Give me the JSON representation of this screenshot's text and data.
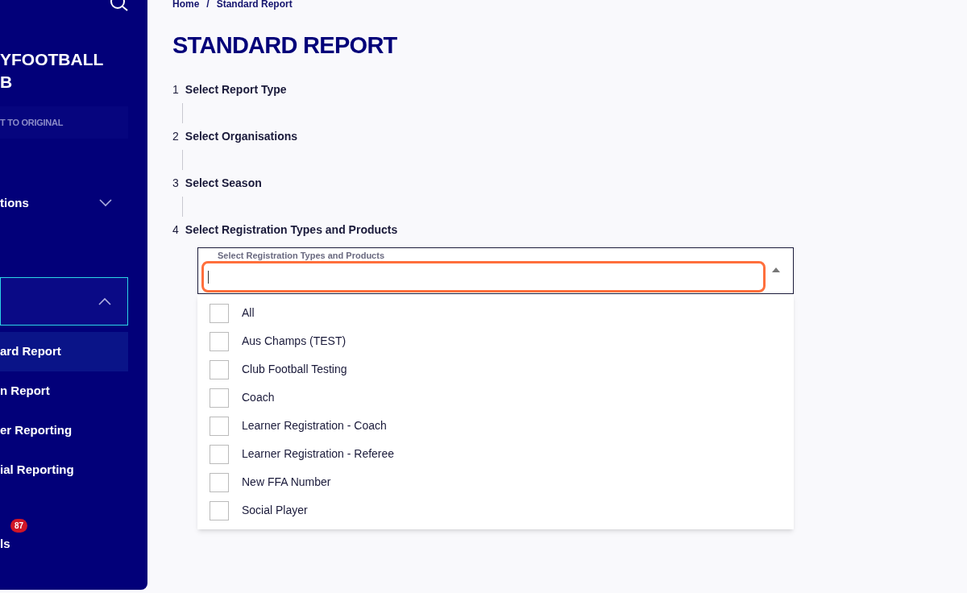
{
  "sidebar": {
    "club_name": [
      "YFOOTBALL",
      "B"
    ],
    "reset_button": "T TO ORIGINAL",
    "items": [
      {
        "label": "tions",
        "kind": "group",
        "expanded": false
      },
      {
        "kind": "active_group",
        "expanded": true
      },
      {
        "label": "ard Report",
        "kind": "sub",
        "selected": true
      },
      {
        "label": "n Report",
        "kind": "sub",
        "selected": false
      },
      {
        "label": "er Reporting",
        "kind": "sub",
        "selected": false
      },
      {
        "label": "ial Reporting",
        "kind": "sub",
        "selected": false
      },
      {
        "label": "ls",
        "kind": "badge",
        "badge": "87"
      }
    ]
  },
  "breadcrumb": [
    "Home",
    "/",
    "Standard Report"
  ],
  "title": "STANDARD REPORT",
  "steps": [
    {
      "number": "1",
      "label": "Select Report Type"
    },
    {
      "number": "2",
      "label": "Select Organisations"
    },
    {
      "number": "3",
      "label": "Select Season"
    },
    {
      "number": "4",
      "label": "Select Registration Types and Products"
    }
  ],
  "dropdown": {
    "label": "Select Registration Types and Products",
    "expanded": true,
    "options": [
      {
        "label": "All",
        "checked": false
      },
      {
        "label": "Aus Champs (TEST)",
        "checked": false
      },
      {
        "label": "Club Football Testing",
        "checked": false
      },
      {
        "label": "Coach",
        "checked": false
      },
      {
        "label": "Learner Registration - Coach",
        "checked": false
      },
      {
        "label": "Learner Registration - Referee",
        "checked": false
      },
      {
        "label": "New FFA Number",
        "checked": false
      },
      {
        "label": "Social Player",
        "checked": false
      }
    ]
  }
}
